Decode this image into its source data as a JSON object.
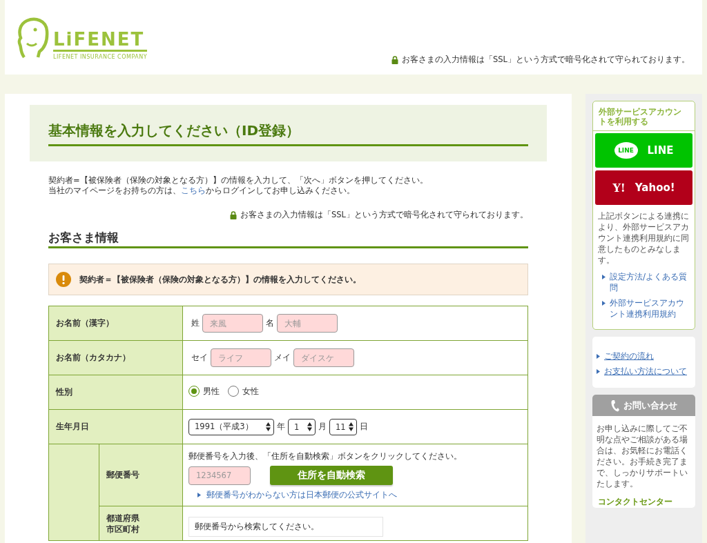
{
  "header": {
    "logo_text": "LiFENET",
    "logo_subtext": "LIFENET INSURANCE COMPANY",
    "ssl_notice": "お客さまの入力情報は「SSL」という方式で暗号化されて守られております。"
  },
  "main": {
    "title": "基本情報を入力してください（ID登録）",
    "intro_line": "契約者=【被保険者（保険の対象となる方）】の情報を入力して、「次へ」ボタンを押してください。",
    "login_line": {
      "before": "当社のマイページをお持ちの方は、",
      "link": "こちら",
      "after": "からログインしてお申し込みください。"
    },
    "ssl_notice": "お客さまの入力情報は「SSL」という方式で暗号化されて守られております。",
    "section_title": "お客さま情報",
    "alert": "契約者＝【被保険者（保険の対象となる方）】の情報を入力してください。",
    "form": [
      {
        "kind": "name",
        "label": "お名前（漢字）",
        "fields": [
          {
            "prefix": "姓",
            "placeholder": "来風"
          },
          {
            "prefix": "名",
            "placeholder": "大輔"
          }
        ]
      },
      {
        "kind": "name",
        "label": "お名前（カタカナ）",
        "fields": [
          {
            "prefix": "セイ",
            "placeholder": "ライフ"
          },
          {
            "prefix": "メイ",
            "placeholder": "ダイスケ"
          }
        ]
      },
      {
        "kind": "radio",
        "label": "性別",
        "options": [
          {
            "label": "男性",
            "selected": true
          },
          {
            "label": "女性",
            "selected": false
          }
        ]
      },
      {
        "kind": "date",
        "label": "生年月日",
        "selects": [
          {
            "value": "1991（平成3）",
            "suffix": "年"
          },
          {
            "value": "1",
            "suffix": "月"
          },
          {
            "value": "11",
            "suffix": "日"
          }
        ]
      },
      {
        "kind": "group",
        "children": [
          {
            "kind": "postal",
            "label": "郵便番号",
            "instruction": "郵便番号を入力後、「住所を自動検索」ボタンをクリックしてください。",
            "placeholder": "1234567",
            "button": "住所を自動検索",
            "link": "郵便番号がわからない方は日本郵便の公式サイトへ"
          },
          {
            "kind": "address",
            "label_lines": [
              "都道府県",
              "市区町村"
            ],
            "value": "郵便番号から検索してください。"
          }
        ]
      }
    ]
  },
  "sidebar": {
    "external": {
      "title": "外部サービスアカウントを利用する",
      "buttons": [
        {
          "kind": "line",
          "icon_text": "LINE",
          "label": "LINE"
        },
        {
          "kind": "yahoo",
          "icon_text": "Y!",
          "label": "Yahoo!"
        }
      ],
      "note": "上記ボタンによる連携により、外部サービスアカウント連携利用規約に同意したものとみなします。",
      "links": [
        "設定方法/よくある質問",
        "外部サービスアカウント連携利用規約"
      ]
    },
    "guide_links": [
      "ご契約の流れ",
      "お支払い方法について"
    ],
    "contact": {
      "title": "お問い合わせ",
      "text": "お申し込みに際してご不明な点やご相談がある場合は、お気軽にお電話ください。お手続き完了まで、しっかりサポートいたします。",
      "center_title": "コンタクトセンター"
    }
  }
}
